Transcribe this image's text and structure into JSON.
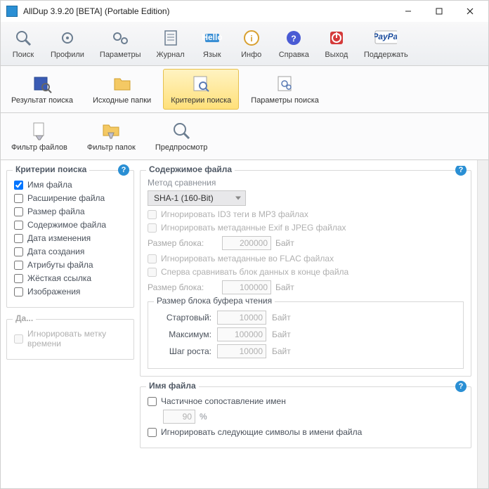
{
  "window": {
    "title": "AllDup 3.9.20 [BETA] (Portable Edition)"
  },
  "main_toolbar": [
    {
      "id": "search",
      "label": "Поиск"
    },
    {
      "id": "profiles",
      "label": "Профили"
    },
    {
      "id": "params",
      "label": "Параметры"
    },
    {
      "id": "log",
      "label": "Журнал"
    },
    {
      "id": "lang",
      "label": "Язык"
    },
    {
      "id": "info",
      "label": "Инфо"
    },
    {
      "id": "help",
      "label": "Справка"
    },
    {
      "id": "exit",
      "label": "Выход"
    },
    {
      "id": "donate",
      "label": "Поддержать"
    }
  ],
  "sec_toolbar": [
    {
      "id": "results",
      "label": "Результат поиска"
    },
    {
      "id": "src-folders",
      "label": "Исходные папки"
    },
    {
      "id": "criteria",
      "label": "Критерии поиска",
      "active": true
    },
    {
      "id": "search-params",
      "label": "Параметры поиска"
    }
  ],
  "third_toolbar": [
    {
      "id": "file-filter",
      "label": "Фильтр файлов"
    },
    {
      "id": "folder-filter",
      "label": "Фильтр папок"
    },
    {
      "id": "preview",
      "label": "Предпросмотр"
    }
  ],
  "criteria": {
    "title": "Критерии поиска",
    "items": [
      {
        "label": "Имя файла",
        "checked": true
      },
      {
        "label": "Расширение файла",
        "checked": false
      },
      {
        "label": "Размер файла",
        "checked": false
      },
      {
        "label": "Содержимое файла",
        "checked": false
      },
      {
        "label": "Дата изменения",
        "checked": false
      },
      {
        "label": "Дата создания",
        "checked": false
      },
      {
        "label": "Атрибуты файла",
        "checked": false
      },
      {
        "label": "Жёсткая ссылка",
        "checked": false
      },
      {
        "label": "Изображения",
        "checked": false
      }
    ]
  },
  "date_group": {
    "title": "Да...",
    "ignore_ts": "Игнорировать метку времени"
  },
  "content": {
    "title": "Содержимое файла",
    "method_label": "Метод сравнения",
    "method_value": "SHA-1 (160-Bit)",
    "ignore_id3": "Игнорировать ID3 теги в MP3 файлах",
    "ignore_exif": "Игнорировать метаданные Exif в JPEG файлах",
    "block_size_label": "Размер блока:",
    "block_size1": "200000",
    "unit": "Байт",
    "ignore_flac": "Игнорировать метаданные во FLAC файлах",
    "cmp_end": "Сперва сравнивать блок данных в конце файла",
    "block_size2": "100000",
    "buffer": {
      "title": "Размер блока буфера чтения",
      "start_label": "Стартовый:",
      "start": "10000",
      "max_label": "Максимум:",
      "max": "100000",
      "step_label": "Шаг роста:",
      "step": "10000"
    }
  },
  "filename": {
    "title": "Имя файла",
    "partial": "Частичное сопоставление имен",
    "percent": "90",
    "pct_sym": "%",
    "ignore_chars": "Игнорировать следующие символы в имени файла"
  }
}
